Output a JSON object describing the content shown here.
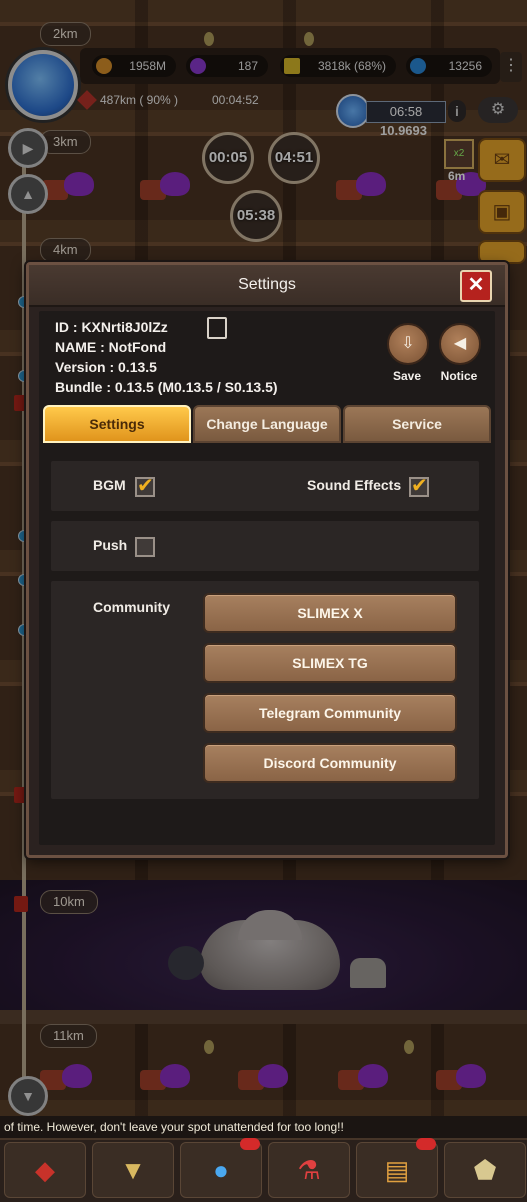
{
  "hud": {
    "gold": "1958M",
    "gem": "187",
    "cargo": "3818k (68%)",
    "crystal": "13256",
    "depth": "487km ( 90% )",
    "session_time": "00:04:52",
    "timer": "06:58",
    "timer_sub": "10.9693",
    "info": "i",
    "boost_time": "6m"
  },
  "map": {
    "km_labels": [
      "2km",
      "3km",
      "4km",
      "10km",
      "11km"
    ],
    "bubbles": [
      "00:05",
      "04:51",
      "05:38"
    ]
  },
  "settings": {
    "title": "Settings",
    "close": "✕",
    "id": "ID : KXNrti8J0lZz",
    "name": "NAME : NotFond",
    "version": "Version : 0.13.5",
    "bundle": "Bundle : 0.13.5 (M0.13.5 / S0.13.5)",
    "save_label": "Save",
    "notice_label": "Notice",
    "tabs": [
      "Settings",
      "Change Language",
      "Service"
    ],
    "options": {
      "bgm": {
        "label": "BGM",
        "checked": true
      },
      "sound": {
        "label": "Sound Effects",
        "checked": true
      },
      "push": {
        "label": "Push",
        "checked": false
      }
    },
    "community": {
      "label": "Community",
      "buttons": [
        "SLIMEX X",
        "SLIMEX TG",
        "Telegram Community",
        "Discord Community"
      ]
    }
  },
  "ticker": "of time. However, don't leave your  spot unattended for too long!!",
  "bottom_nav": [
    "ore-icon",
    "drill-icon",
    "slime-icon",
    "potion-icon",
    "quest-icon",
    "rank-icon"
  ]
}
